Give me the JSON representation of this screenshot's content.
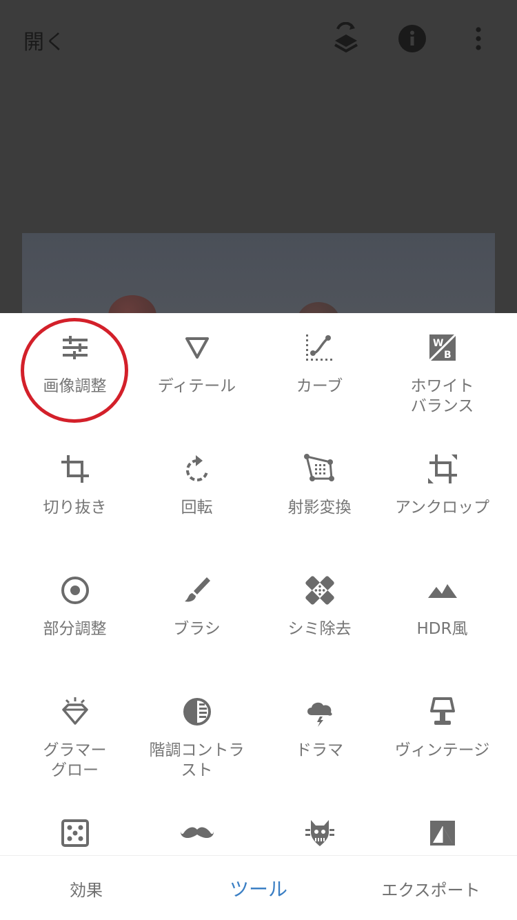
{
  "header": {
    "open_label": "開く",
    "icons": [
      "layers-icon",
      "info-icon",
      "more-vert-icon"
    ]
  },
  "tools": [
    {
      "label": "画像調整",
      "icon": "tune-icon"
    },
    {
      "label": "ディテール",
      "icon": "triangle-icon"
    },
    {
      "label": "カーブ",
      "icon": "curves-icon"
    },
    {
      "label": "ホワイト\nバランス",
      "icon": "white-balance-icon"
    },
    {
      "label": "切り抜き",
      "icon": "crop-icon"
    },
    {
      "label": "回転",
      "icon": "rotate-icon"
    },
    {
      "label": "射影変換",
      "icon": "perspective-icon"
    },
    {
      "label": "アンクロップ",
      "icon": "expand-icon"
    },
    {
      "label": "部分調整",
      "icon": "selective-icon"
    },
    {
      "label": "ブラシ",
      "icon": "brush-icon"
    },
    {
      "label": "シミ除去",
      "icon": "healing-icon"
    },
    {
      "label": "HDR風",
      "icon": "hdr-icon"
    },
    {
      "label": "グラマー\nグロー",
      "icon": "diamond-icon"
    },
    {
      "label": "階調コントラ\nスト",
      "icon": "tonal-contrast-icon"
    },
    {
      "label": "ドラマ",
      "icon": "drama-icon"
    },
    {
      "label": "ヴィンテージ",
      "icon": "vintage-lamp-icon"
    },
    {
      "label": "",
      "icon": "grainy-film-icon"
    },
    {
      "label": "",
      "icon": "mustache-icon"
    },
    {
      "label": "",
      "icon": "grunge-icon"
    },
    {
      "label": "",
      "icon": "black-white-icon"
    }
  ],
  "bottom_tabs": {
    "effects": "効果",
    "tools": "ツール",
    "export": "エクスポート"
  },
  "colors": {
    "active_tab": "#3b7fc4",
    "highlight": "#d3202a",
    "icon": "#6b6b6b"
  }
}
